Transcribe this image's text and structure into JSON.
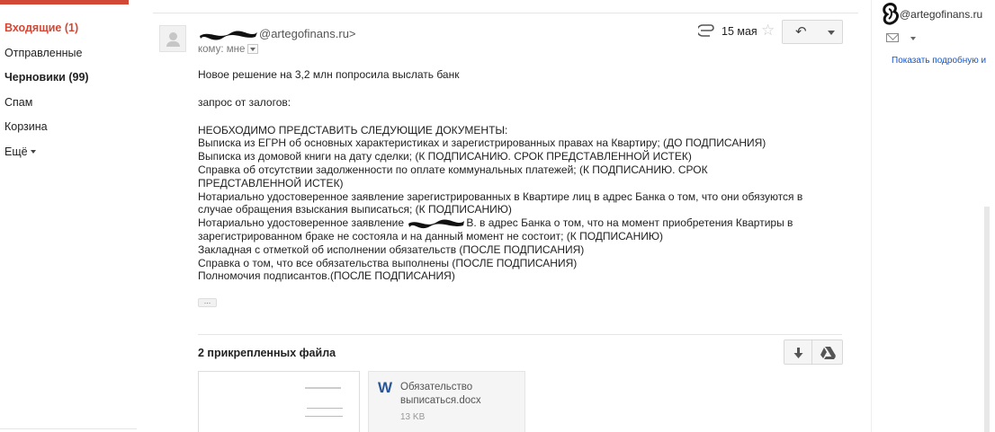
{
  "nav": {
    "items": [
      {
        "label": "Входящие (1)"
      },
      {
        "label": "Отправленные"
      },
      {
        "label": "Черновики (99)"
      },
      {
        "label": "Спам"
      },
      {
        "label": "Корзина"
      },
      {
        "label": "Ещё"
      }
    ]
  },
  "message": {
    "sender_domain": "@artegofinans.ru>",
    "recipient": "кому: мне",
    "date": "15 мая",
    "star": "☆",
    "reply_glyph": "↶",
    "body": {
      "line1": "Новое решение на 3,2 млн попросила выслать банк",
      "line2": "запрос от залогов:",
      "line3": "НЕОБХОДИМО ПРЕДСТАВИТЬ СЛЕДУЮЩИЕ ДОКУМЕНТЫ:",
      "line4": "Выписка из ЕГРН об основных характеристиках и зарегистрированных правах на Квартиру; (ДО ПОДПИСАНИЯ)",
      "line5": "Выписка из домовой книги на дату сделки; (К ПОДПИСАНИЮ. СРОК ПРЕДСТАВЛЕННОЙ ИСТЕК)",
      "line6": "Справка об отсутствии задолженности по оплате коммунальных платежей; (К ПОДПИСАНИЮ. СРОК",
      "line7": "ПРЕДСТАВЛЕННОЙ ИСТЕК)",
      "line8": "Нотариально удостоверенное заявление зарегистрированных в Квартире лиц в адрес Банка о том, что они обязуются в",
      "line9": "случае обращения взыскания выписаться; (К ПОДПИСАНИЮ)",
      "line10_a": "Нотариально удостоверенное заявление ",
      "line10_b": "В. в адрес Банка о том, что на момент приобретения Квартиры в",
      "line11": "зарегистрированном браке не состояла и на данный момент не состоит; (К ПОДПИСАНИЮ)",
      "line12": "Закладная с отметкой об исполнении обязательств (ПОСЛЕ ПОДПИСАНИЯ)",
      "line13": "Справка о том, что все обязательства выполнены (ПОСЛЕ ПОДПИСАНИЯ)",
      "line14": "Полномочия подписантов.(ПОСЛЕ ПОДПИСАНИЯ)"
    },
    "ellipsis": "...",
    "attachments": {
      "title": "2 прикрепленных файла",
      "file": {
        "icon_letter": "W",
        "name": "Обязательство выписаться.docx",
        "size": "13 KB"
      }
    }
  },
  "right_panel": {
    "email": "@artegofinans.ru",
    "link": "Показать подробную и"
  },
  "colors": {
    "accent": "#d14836",
    "link": "#1155cc",
    "word_blue": "#2a5699"
  }
}
